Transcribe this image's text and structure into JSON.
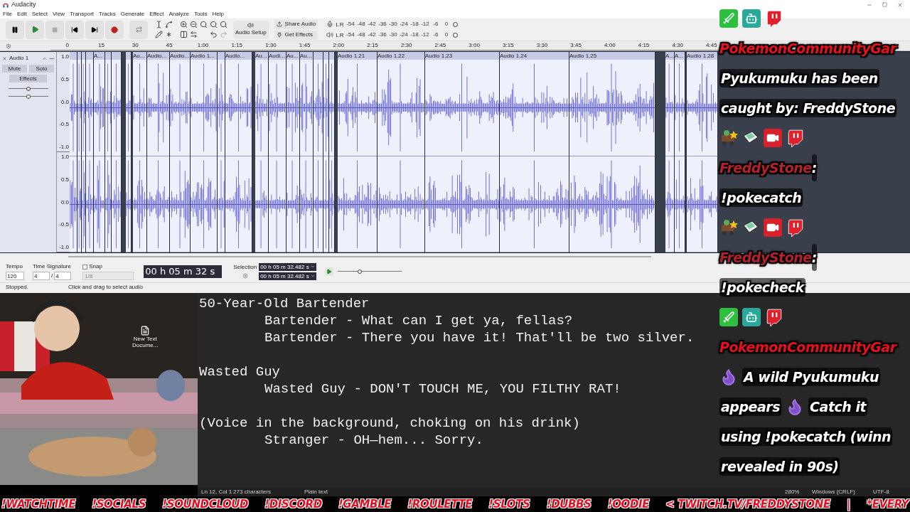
{
  "window": {
    "title": "Audacity"
  },
  "menu": [
    "File",
    "Edit",
    "Select",
    "View",
    "Transport",
    "Tracks",
    "Generate",
    "Effect",
    "Analyze",
    "Tools",
    "Help"
  ],
  "toolbar": {
    "audio_setup": "Audio Setup",
    "share_audio": "Share Audio",
    "get_effects": "Get Effects",
    "meters": [
      {
        "kind": "record",
        "channels": [
          "L",
          "R"
        ],
        "ticks": [
          "-54",
          "-48",
          "-42",
          "-36",
          "-30",
          "-24",
          "-18",
          "-12",
          "-6",
          "0"
        ]
      },
      {
        "kind": "playback",
        "channels": [
          "L",
          "R"
        ],
        "ticks": [
          "-54",
          "-48",
          "-42",
          "-36",
          "-30",
          "-24",
          "-18",
          "-12",
          "-6",
          "0"
        ]
      }
    ]
  },
  "ruler": [
    "0",
    "15",
    "30",
    "45",
    "1:00",
    "1:15",
    "1:30",
    "1:45",
    "2:00",
    "2:15",
    "2:30",
    "2:45",
    "3:00",
    "3:15",
    "3:30",
    "3:45",
    "4:00",
    "4:15",
    "4:30",
    "4:45"
  ],
  "track": {
    "name": "Audio 1",
    "buttons": [
      "Mute",
      "Solo"
    ],
    "effects": "Effects",
    "sliders": [
      {
        "level": 0.5
      },
      {
        "level": 0.5
      }
    ],
    "channels": [
      {
        "scale": [
          "1.0",
          "0.5",
          "0.0",
          "-0.5",
          "-1.0"
        ]
      },
      {
        "scale": [
          "1.0",
          "0.5",
          "0.0",
          "-0.5",
          "-1.0"
        ]
      }
    ],
    "clips": [
      {
        "label": "A..."
      },
      {
        "label": "Au..."
      },
      {
        "label": "Audio..."
      },
      {
        "label": "Audio..."
      },
      {
        "label": "Audio 1..."
      },
      {
        "label": "Audio..."
      },
      {
        "label": "Au..."
      },
      {
        "label": "Audi..."
      },
      {
        "label": "Au..."
      },
      {
        "label": "Au..."
      },
      {
        "label": "Audio 1.21"
      },
      {
        "label": "Audio 1.22"
      },
      {
        "label": "Audio 1.23"
      },
      {
        "label": "Audio 1.24"
      },
      {
        "label": "Audio 1.25"
      },
      {
        "label": "A..."
      },
      {
        "label": "A..."
      },
      {
        "label": "Audio 1.28"
      }
    ]
  },
  "bottom_toolbar": {
    "tempo_label": "Tempo",
    "tempo": "120",
    "time_signature_label": "Time Signature",
    "beats": "4",
    "slash": "/",
    "unit": "4",
    "snap": {
      "label": "Snap",
      "checked": false
    },
    "snap_value": "1/8",
    "time": "00 h 05 m 32 s",
    "selection_label": "Selection",
    "selection": [
      "00 h 05 m 32.482 s",
      "00 h 05 m 32.482 s"
    ],
    "speed": {
      "level": 0.35
    }
  },
  "status_bar": [
    "Stopped.",
    "Click and drag to select audio"
  ],
  "desktop_icon": {
    "lines": [
      "New Text",
      "Docume..."
    ]
  },
  "notepad": {
    "paragraphs": [
      {
        "heading": "50-Year-Old Bartender",
        "lines": [
          "Bartender - What can I get ya, fellas?",
          "Bartender - There you have it! That'll be two silver."
        ]
      },
      {
        "heading": "Wasted Guy",
        "lines": [
          "Wasted Guy - DON'T TOUCH ME, YOU FILTHY RAT!"
        ]
      },
      {
        "heading": "(Voice in the background, choking on his drink)",
        "lines": [
          "Stranger - OH—hem... Sorry."
        ]
      }
    ],
    "status": [
      "Ln 12, Col 1",
      "273 characters",
      "Plain text",
      "280%",
      "Windows (CRLF)",
      "UTF-8"
    ]
  },
  "chat": [
    {
      "kind": "bot",
      "author": "PokemonCommunityGar",
      "color": "#e8101a",
      "lines": [
        [
          {
            "kind": "text",
            "text": "Pyukumuku has been"
          }
        ],
        [
          {
            "kind": "text",
            "text": "caught by: FreddyStone"
          }
        ]
      ]
    },
    {
      "kind": "viewer",
      "author": "FreddyStone",
      "separator": ":",
      "color": "#b3222c",
      "lines": [
        [
          {
            "kind": "text",
            "text": "!pokecatch"
          }
        ]
      ]
    },
    {
      "kind": "viewer",
      "author": "FreddyStone",
      "separator": ":",
      "color": "#b3222c",
      "lines": [
        [
          {
            "kind": "text",
            "text": "!pokecheck"
          }
        ]
      ]
    },
    {
      "kind": "bot",
      "author": "PokemonCommunityGar",
      "color": "#e8101a",
      "lines": [
        [
          {
            "kind": "flame"
          },
          {
            "kind": "text",
            "text": "A wild Pyukumuku"
          }
        ],
        [
          {
            "kind": "text",
            "text": "appears"
          },
          {
            "kind": "flame"
          },
          {
            "kind": "text",
            "text": "Catch it"
          }
        ],
        [
          {
            "kind": "text",
            "text": "using !pokecatch (winn"
          }
        ],
        [
          {
            "kind": "text",
            "text": "revealed in 90s)"
          }
        ]
      ]
    }
  ],
  "ticker": [
    "!WATCHTIME",
    "!SOCIALS",
    "!SOUNDCLOUD",
    "!DISCORD",
    "!GAMBLE",
    "!ROULETTE",
    "!SLOTS",
    "!DUBBS",
    "!OODIE",
    "< TWITCH.TV/FREDDYSTONE",
    "|",
    "*EVERY"
  ]
}
